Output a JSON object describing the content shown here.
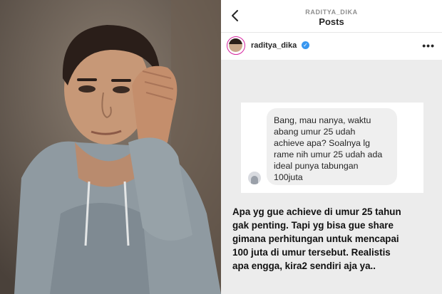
{
  "header": {
    "username": "RADITYA_DIKA",
    "title": "Posts"
  },
  "post": {
    "username": "raditya_dika",
    "verified": true,
    "more": "•••"
  },
  "story": {
    "question": "Bang, mau nanya, waktu\nabang umur 25 udah\nachieve apa? Soalnya lg\nrame nih umur 25 udah ada\nideal punya tabungan\n100juta",
    "answer": "Apa yg gue achieve di umur 25 tahun\ngak penting. Tapi yg bisa gue share\ngimana perhitungan untuk mencapai\n100 juta di umur tersebut. Realistis\napa engga, kira2 sendiri aja ya.."
  },
  "colors": {
    "verified": "#3897f0",
    "story_background": "#ececec",
    "bubble": "#efefef"
  },
  "icons": {
    "back": "chevron-left-icon",
    "verified": "verified-badge-icon",
    "more": "more-options-icon"
  }
}
